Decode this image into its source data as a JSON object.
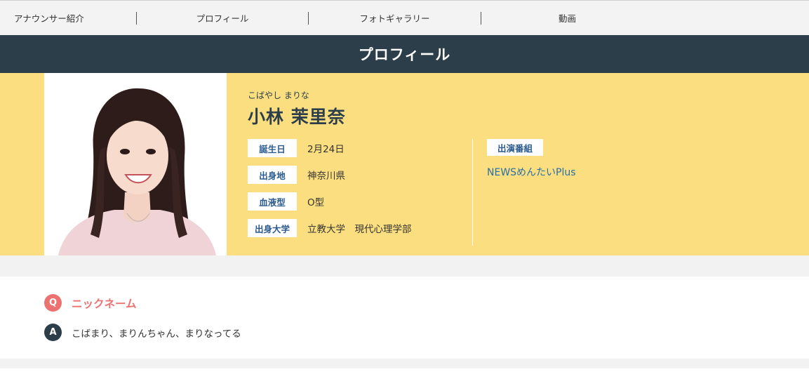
{
  "nav": {
    "items": [
      {
        "label": "アナウンサー紹介"
      },
      {
        "label": "プロフィール"
      },
      {
        "label": "フォトギャラリー"
      },
      {
        "label": "動画"
      }
    ]
  },
  "header": {
    "title": "プロフィール"
  },
  "profile": {
    "reading": "こばやし まりな",
    "name": "小林 茉里奈",
    "fields": [
      {
        "label": "誕生日",
        "value": "2月24日"
      },
      {
        "label": "出身地",
        "value": "神奈川県"
      },
      {
        "label": "血液型",
        "value": "O型"
      },
      {
        "label": "出身大学",
        "value": "立教大学　現代心理学部"
      }
    ],
    "programs": {
      "label": "出演番組",
      "items": [
        "NEWSめんたいPlus"
      ]
    }
  },
  "qa": {
    "q_mark": "Q",
    "a_mark": "A",
    "question": "ニックネーム",
    "answer": "こばまり、まりんちゃん、まりなってる"
  },
  "colors": {
    "title_bg": "#2c3e4a",
    "profile_bg": "#fbde7f",
    "label_text": "#2a5b8e",
    "link": "#2a6ea6",
    "question": "#ec7272"
  }
}
